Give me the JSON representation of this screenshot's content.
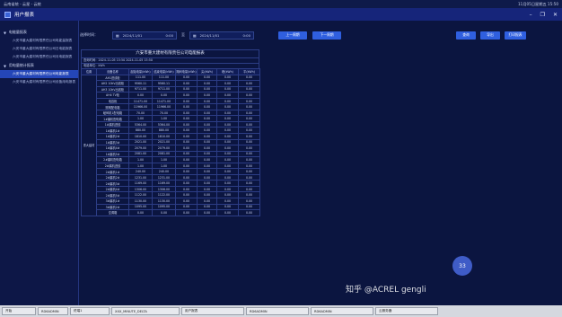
{
  "system": {
    "title": "云南省统 - 云星 - 云统",
    "clock": "11月05日星期五 15:50"
  },
  "app": {
    "title": "用户报表",
    "controls": [
      "–",
      "❐",
      "✕"
    ]
  },
  "sidebar": {
    "groups": [
      {
        "label": "电能量报表",
        "items": [
          {
            "label": "六安市重大建材有限责任公司电能量报表"
          },
          {
            "label": "六安市重大建材有限责任公司日电能报表"
          },
          {
            "label": "六安市重大建材有限责任公司月电能报表"
          }
        ]
      },
      {
        "label": "用电量统计报表",
        "items": [
          {
            "label": "六安市重大建材有限责任公司电能报表",
            "active": true
          },
          {
            "label": "六安市重大建材有限责任公司设备用电报表"
          }
        ]
      }
    ]
  },
  "toolbar": {
    "time_label": "选择时间：",
    "start_date": "2024/11/01",
    "start_time": "0:00",
    "to_label": "至",
    "end_date": "2024/11/01",
    "end_time": "0:00",
    "prev_label": "上一周期",
    "next_label": "下一周期",
    "query_label": "查询",
    "export_label": "导出",
    "print_label": "打印报表",
    "calendar_icon": "calendar-icon"
  },
  "report": {
    "title": "六安市重大建材有限责任公司电能报表",
    "meta_time": "查询时间：2024-11-05 15:50  2024-11-05 15:50",
    "meta_unit": "电能单位：kWh",
    "headers": [
      "位置",
      "设备名称",
      "起始电量(kWh)",
      "结束电量(kWh)",
      "期间电量(kWh)",
      "尖(kWh)",
      "峰(kWh)",
      "平(kWh)"
    ],
    "group_label": "重大建材",
    "rows": [
      [
        "AH1进线柜",
        "111.00",
        "111.00",
        "0.00",
        "0.00",
        "0.00"
      ],
      [
        "AH2 10kV出线柜",
        "9560.11",
        "9560.11",
        "0.00",
        "0.00",
        "0.00"
      ],
      [
        "AH3 10kV出线柜",
        "9711.00",
        "9711.00",
        "0.00",
        "0.00",
        "0.00"
      ],
      [
        "AH4 TV柜",
        "0.00",
        "0.00",
        "0.00",
        "0.00",
        "0.00"
      ],
      [
        "电容柜",
        "11471.00",
        "11471.00",
        "0.00",
        "0.00",
        "0.00"
      ],
      [
        "照明配电箱",
        "11966.00",
        "11966.00",
        "0.00",
        "0.00",
        "0.00"
      ],
      [
        "破碎机1配电箱",
        "70.00",
        "70.00",
        "0.00",
        "0.00",
        "0.00"
      ],
      [
        "1#磨机配电箱",
        "1.00",
        "1.00",
        "0.00",
        "0.00",
        "0.00"
      ],
      [
        "1#磨机进线",
        "5364.00",
        "5364.00",
        "0.00",
        "0.00",
        "0.00"
      ],
      [
        "1#磨机1#",
        "880.00",
        "880.00",
        "0.00",
        "0.00",
        "0.00"
      ],
      [
        "1#磨机2#",
        "1810.00",
        "1810.00",
        "0.00",
        "0.00",
        "0.00"
      ],
      [
        "1#磨机3#",
        "2021.00",
        "2021.00",
        "0.00",
        "0.00",
        "0.00"
      ],
      [
        "1#磨机4#",
        "2079.00",
        "2079.00",
        "0.00",
        "0.00",
        "0.00"
      ],
      [
        "1#磨机5#",
        "2081.00",
        "2081.00",
        "0.00",
        "0.00",
        "0.00"
      ],
      [
        "2#磨机配电箱",
        "1.00",
        "1.00",
        "0.00",
        "0.00",
        "0.00"
      ],
      [
        "2#磨机进线",
        "1.00",
        "1.00",
        "0.00",
        "0.00",
        "0.00"
      ],
      [
        "2#磨机1#",
        "240.00",
        "240.00",
        "0.00",
        "0.00",
        "0.00"
      ],
      [
        "2#磨机2#",
        "1231.00",
        "1231.00",
        "0.00",
        "0.00",
        "0.00"
      ],
      [
        "2#磨机3#",
        "1169.00",
        "1169.00",
        "0.00",
        "0.00",
        "0.00"
      ],
      [
        "2#磨机4#",
        "1306.00",
        "1306.00",
        "0.00",
        "0.00",
        "0.00"
      ],
      [
        "2#磨机5#",
        "1122.00",
        "1122.00",
        "0.00",
        "0.00",
        "0.00"
      ],
      [
        "3#磨机1#",
        "1130.00",
        "1130.00",
        "0.00",
        "0.00",
        "0.00"
      ],
      [
        "3#磨机2#",
        "1095.00",
        "1095.00",
        "0.00",
        "0.00",
        "0.00"
      ],
      [
        "空调箱",
        "0.00",
        "0.00",
        "0.00",
        "0.00",
        "0.00"
      ]
    ]
  },
  "badge": "33",
  "watermark": "知乎 @ACREL gengli",
  "taskbar": [
    "开始",
    "RD6ADMIN",
    "终端1",
    "XXX_MINUTE_DELTA",
    "用户报表",
    "RD6ADMIN",
    "RD6ADMIN",
    "云服务器"
  ]
}
